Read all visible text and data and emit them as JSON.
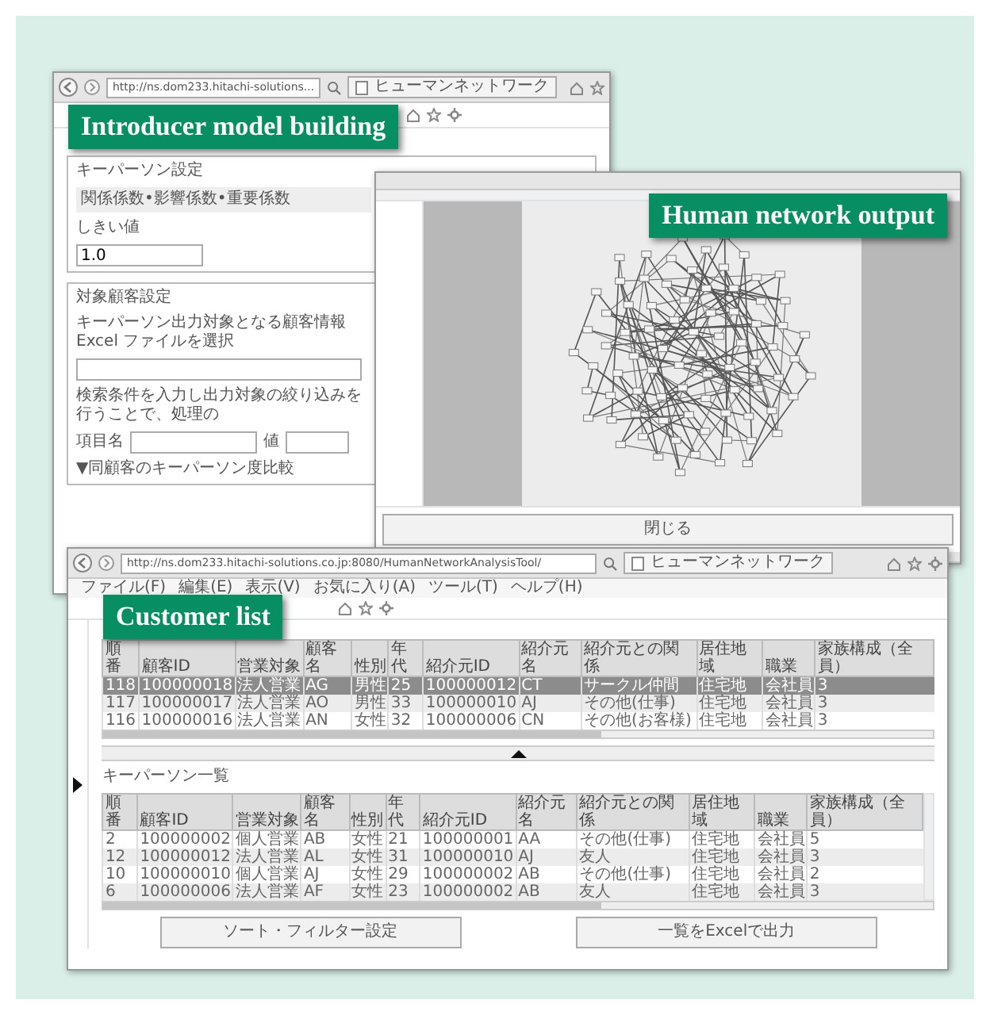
{
  "model_building_window": {
    "caption": "Introducer model building",
    "address": "http://ns.dom233.hitachi-solutions...",
    "tab_title": "ヒューマンネットワーク",
    "keyperson_section": {
      "title": "キーパーソン設定",
      "coefficient_row": "関係係数•影響係数•重要係数",
      "threshold_label": "しきい値",
      "threshold_value": "1.0"
    },
    "target_section": {
      "title": "対象顧客設定",
      "file_prompt": "キーパーソン出力対象となる顧客情報 Excel ファイルを選択",
      "filter_prompt": "検索条件を入力し出力対象の絞り込みを行うことで、処理の",
      "field_label": "項目名",
      "value_label": "値",
      "compare_toggle": "▼同顧客のキーパーソン度比較"
    }
  },
  "network_window": {
    "caption": "Human network output",
    "close_button": "閉じる"
  },
  "customer_list_window": {
    "caption": "Customer list",
    "address": "http://ns.dom233.hitachi-solutions.co.jp:8080/HumanNetworkAnalysisTool/",
    "tab_title": "ヒューマンネットワーク",
    "menu": [
      "ファイル(F)",
      "編集(E)",
      "表示(V)",
      "お気に入り(A)",
      "ツール(T)",
      "ヘルプ(H)"
    ],
    "upper_table": {
      "columns": [
        "順番",
        "顧客ID",
        "営業対象",
        "顧客名",
        "性別",
        "年代",
        "紹介元ID",
        "紹介元名",
        "紹介元との関係",
        "居住地域",
        "職業",
        "家族構成（全員）"
      ],
      "rows": [
        {
          "cells": [
            "118",
            "100000018",
            "法人営業",
            "AG",
            "男性",
            "25",
            "100000012",
            "CT",
            "サークル仲間",
            "住宅地",
            "会社員",
            "3"
          ],
          "selected": true
        },
        {
          "cells": [
            "117",
            "100000017",
            "法人営業",
            "AO",
            "男性",
            "33",
            "100000010",
            "AJ",
            "その他(仕事)",
            "住宅地",
            "会社員",
            "3"
          ],
          "selected": false
        },
        {
          "cells": [
            "116",
            "100000016",
            "法人営業",
            "AN",
            "女性",
            "32",
            "100000006",
            "CN",
            "その他(お客様)",
            "住宅地",
            "会社員",
            "3"
          ],
          "selected": false
        }
      ]
    },
    "keyperson_title": "キーパーソン一覧",
    "lower_table": {
      "columns": [
        "順番",
        "顧客ID",
        "営業対象",
        "顧客名",
        "性別",
        "年代",
        "紹介元ID",
        "紹介元名",
        "紹介元との関係",
        "居住地域",
        "職業",
        "家族構成（全員）"
      ],
      "rows": [
        {
          "cells": [
            "2",
            "100000002",
            "個人営業",
            "AB",
            "女性",
            "21",
            "100000001",
            "AA",
            "その他(仕事)",
            "住宅地",
            "会社員",
            "5"
          ],
          "selected": false
        },
        {
          "cells": [
            "12",
            "100000012",
            "法人営業",
            "AL",
            "女性",
            "31",
            "100000010",
            "AJ",
            "友人",
            "住宅地",
            "会社員",
            "3"
          ],
          "selected": false
        },
        {
          "cells": [
            "10",
            "100000010",
            "個人営業",
            "AJ",
            "女性",
            "29",
            "100000002",
            "AB",
            "その他(仕事)",
            "住宅地",
            "会社員",
            "2"
          ],
          "selected": false
        },
        {
          "cells": [
            "6",
            "100000006",
            "法人営業",
            "AF",
            "女性",
            "23",
            "100000002",
            "AB",
            "友人",
            "住宅地",
            "会社員",
            "3"
          ],
          "selected": false
        }
      ]
    },
    "buttons": [
      "ソート・フィルター設定",
      "一覧をExcelで出力"
    ]
  }
}
